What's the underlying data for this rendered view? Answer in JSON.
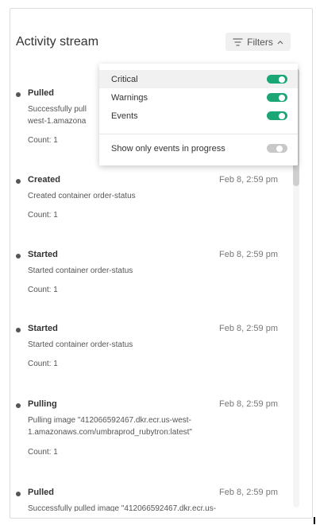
{
  "header": {
    "title": "Activity stream",
    "filters_label": "Filters"
  },
  "events": [
    {
      "title": "Pulled",
      "time": "",
      "message": "Successfully pulled image \"412066592467.dkr.ecr.us-west-1.amazonaws.com/umbraprod_rubytron:latest\"",
      "count": "Count: 1"
    },
    {
      "title": "Created",
      "time": "Feb 8, 2:59 pm",
      "message": "Created container order-status",
      "count": "Count: 1"
    },
    {
      "title": "Started",
      "time": "Feb 8, 2:59 pm",
      "message": "Started container order-status",
      "count": "Count: 1"
    },
    {
      "title": "Started",
      "time": "Feb 8, 2:59 pm",
      "message": "Started container order-status",
      "count": "Count: 1"
    },
    {
      "title": "Pulling",
      "time": "Feb 8, 2:59 pm",
      "message": "Pulling image \"412066592467.dkr.ecr.us-west-1.amazonaws.com/umbraprod_rubytron:latest\"",
      "count": "Count: 1"
    },
    {
      "title": "Pulled",
      "time": "Feb 8, 2:59 pm",
      "message": "Successfully pulled image \"412066592467.dkr.ecr.us-",
      "count": ""
    }
  ],
  "event_0_visible": {
    "message_line1": "Successfully pull",
    "message_line2": "west-1.amazona"
  },
  "filters_menu": {
    "items": [
      {
        "label": "Critical",
        "enabled": true
      },
      {
        "label": "Warnings",
        "enabled": true
      },
      {
        "label": "Events",
        "enabled": true
      }
    ],
    "in_progress": {
      "label": "Show only events in progress",
      "enabled": false
    }
  },
  "colors": {
    "toggle_on": "#1aa775",
    "toggle_off": "#c8c8c8"
  }
}
